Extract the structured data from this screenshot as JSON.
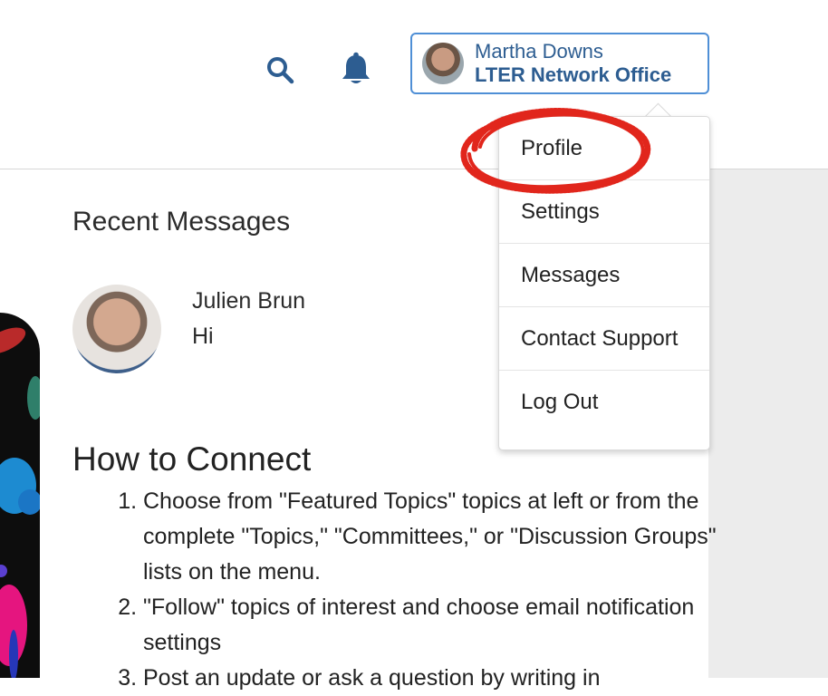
{
  "header": {
    "search_icon": "search-icon",
    "notifications_icon": "bell-icon",
    "user": {
      "name": "Martha Downs",
      "organization": "LTER Network Office",
      "avatar": "user-avatar"
    }
  },
  "dropdown": {
    "items": [
      {
        "label": "Profile"
      },
      {
        "label": "Settings"
      },
      {
        "label": "Messages"
      },
      {
        "label": "Contact Support"
      },
      {
        "label": "Log Out"
      }
    ],
    "highlight_color": "#e1261c"
  },
  "recent_messages": {
    "title": "Recent Messages",
    "items": [
      {
        "sender": "Julien Brun",
        "text": "Hi"
      }
    ]
  },
  "how_to_connect": {
    "title": "How to Connect",
    "steps": [
      "Choose from \"Featured Topics\" topics at left or from the complete \"Topics,\" \"Committees,\" or \"Discussion Groups\" lists on the menu.",
      "\"Follow\" topics of interest and choose email notification settings",
      "Post an update or ask a question by writing in"
    ]
  },
  "colors": {
    "accent": "#2d5d91",
    "button_border": "#4f8fd6",
    "panel": "#ececec"
  }
}
